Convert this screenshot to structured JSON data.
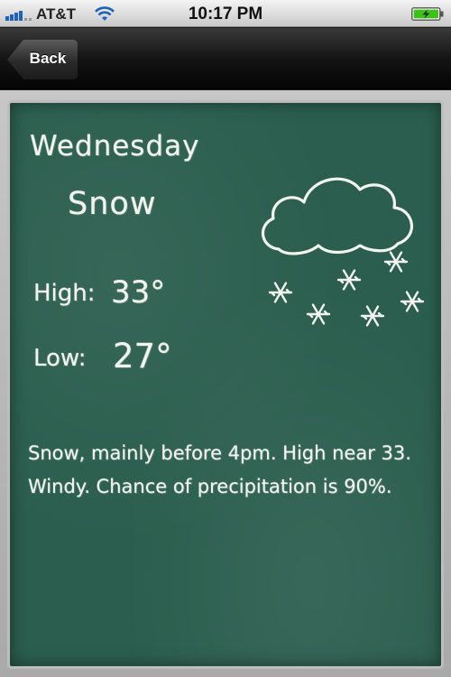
{
  "status_bar": {
    "carrier": "AT&T",
    "time": "10:17 PM",
    "signal_icon": "signal-bars-icon",
    "wifi_icon": "wifi-icon",
    "battery_icon": "battery-charging-icon",
    "battery_color": "#3ec21b"
  },
  "nav": {
    "back_label": "Back"
  },
  "forecast": {
    "day": "Wednesday",
    "condition": "Snow",
    "high_label": "High:",
    "high_value": "33°",
    "low_label": "Low:",
    "low_value": "27°",
    "description": "Snow, mainly before 4pm.  High near 33. Windy.  Chance of precipitation is 90%.",
    "icon": "snow-cloud-icon"
  },
  "colors": {
    "chalkboard": "#2b5e4e",
    "chalk": "#f2f4f0"
  }
}
